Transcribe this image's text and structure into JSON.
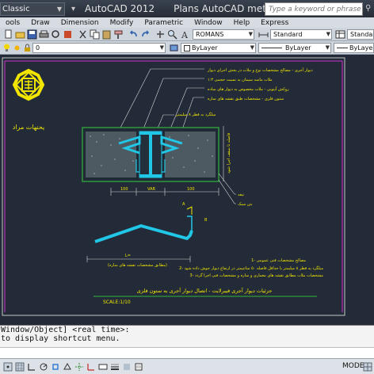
{
  "titlebar": {
    "workspace": "Classic",
    "app_name": "AutoCAD 2012",
    "doc_name": "Plans AutoCAD metal column.d...",
    "search_placeholder": "Type a keyword or phrase"
  },
  "menu": [
    "ools",
    "Draw",
    "Dimension",
    "Modify",
    "Parametric",
    "Window",
    "Help",
    "Express"
  ],
  "toolbar": {
    "text_style": "ROMANS",
    "dim_style": "Standard",
    "table_style": "Standard",
    "layer": "0",
    "color": "ByLayer",
    "linetype": "ByLayer",
    "lineweight": "ByLayer"
  },
  "drawing": {
    "logo_caption": "یحنهات مراد",
    "callouts": [
      "دیوار آجری - مصالح مشخصات نوع و ملات در بخش اجرای دیوار",
      "ملات ماسه سیمان به نسبت حجمی ۱:۳",
      "روکش آیتونی - ملات مخصوص به دیوار های ساده",
      "ستون فلزی - مشخصات طبق نقشه های سازه"
    ],
    "middle_note": "میلگرد به قطر ۸ میلیمتر",
    "vertical_note": "فاصله تا سقف اجرا شود",
    "dim_left": "100",
    "dim_mid": "VAR",
    "dim_right": "100",
    "side_label_1": "تیغه",
    "side_label_2": "بتن سبک",
    "angle_label_1": "A",
    "angle_label_2": "B",
    "profile_dim": "L=",
    "profile_note": "(مطابق مشخصات نقشه های سازه)",
    "notes_title": "1- مصالح مشخصات فنی عمومی",
    "notes": [
      "2- میلگرد به قطر ۸ میلیمتر با حداقل فاصله ۵۰ سانتیمتر در ارتفاع دیوار جوش داده شود",
      "3- مشخصات ملات مطابق نقشه های معماری و سازه و مشخصات فنی اجرا گردد"
    ],
    "main_title": "جزئیات دیوار آجری فیبرلایت - اتصال دیوار آجری به ستون فلزی",
    "scale": "SCALE:1/10"
  },
  "command": {
    "line1": "Window/Object] <real time>:",
    "line2": " to display shortcut menu."
  },
  "status": {
    "model_label": "MODEL"
  },
  "colors": {
    "background": "#232b38",
    "cyan": "#21c7e6",
    "yellow": "#f2e600",
    "magenta": "#d22fd2",
    "green": "#2f9a3a",
    "red": "#e23030"
  }
}
